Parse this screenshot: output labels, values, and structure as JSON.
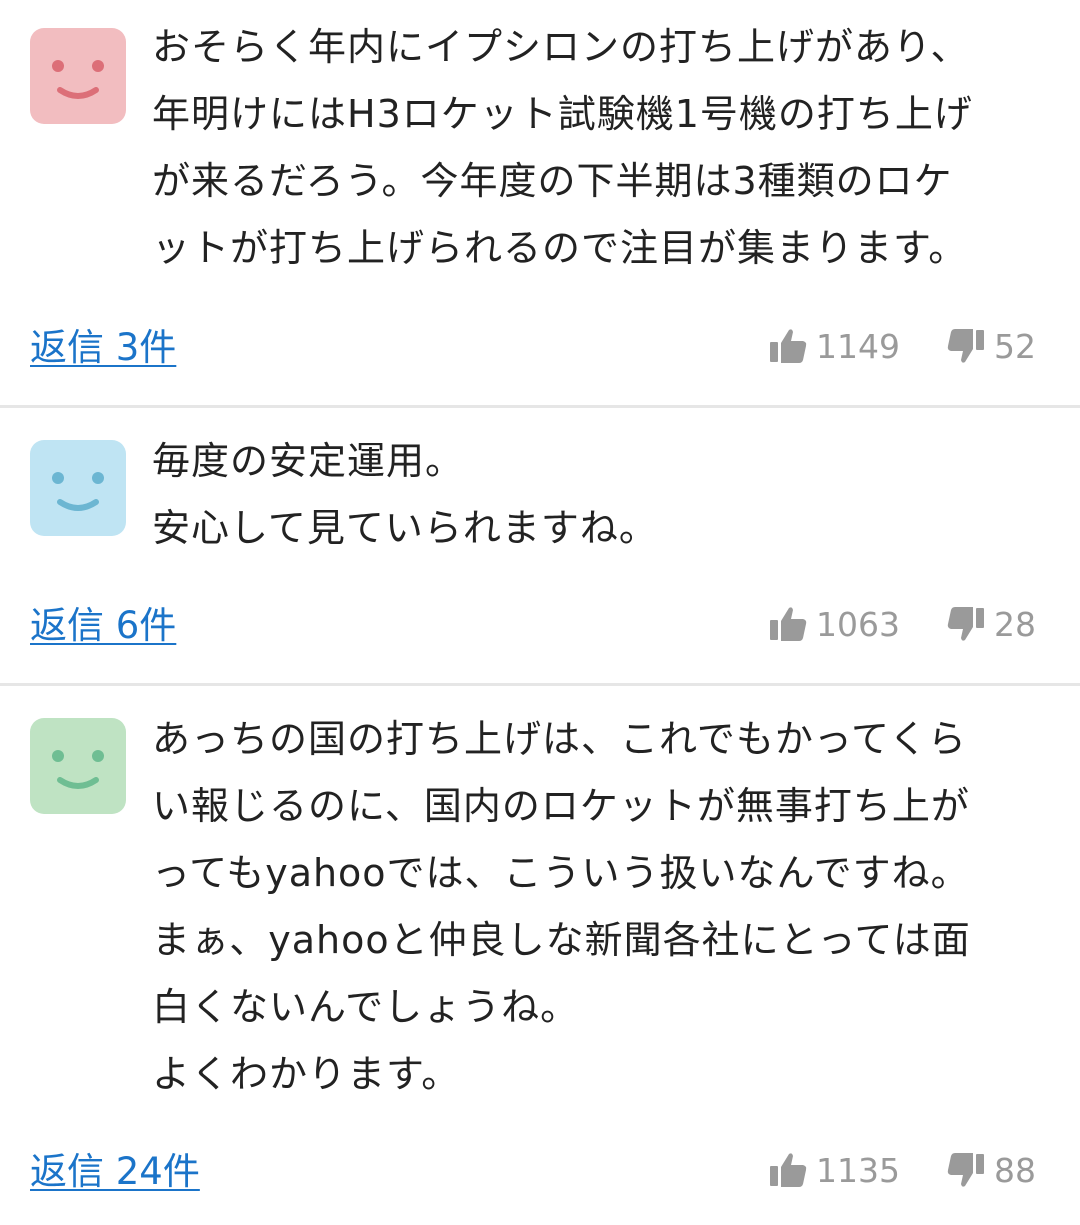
{
  "comments": [
    {
      "avatar_color": "#f2bdc0",
      "avatar_face_color": "#dc6f78",
      "lines": [
        "おそらく年内にイプシロンの打ち上げがあり、",
        "年明けにはH3ロケット試験機1号機の打ち上げ",
        "が来るだろう。今年度の下半期は3種類のロケ",
        "ットが打ち上げられるので注目が集まります。"
      ],
      "reply_label": "返信 3件",
      "likes": "1149",
      "dislikes": "52"
    },
    {
      "avatar_color": "#bfe4f3",
      "avatar_face_color": "#6cb6d2",
      "lines": [
        "毎度の安定運用。",
        "安心して見ていられますね。"
      ],
      "reply_label": "返信 6件",
      "likes": "1063",
      "dislikes": "28"
    },
    {
      "avatar_color": "#bfe3c3",
      "avatar_face_color": "#6fbe93",
      "lines": [
        "あっちの国の打ち上げは、これでもかってくら",
        "い報じるのに、国内のロケットが無事打ち上が",
        "ってもyahooでは、こういう扱いなんですね。",
        "まぁ、yahooと仲良しな新聞各社にとっては面",
        "白くないんでしょうね。",
        "よくわかります。"
      ],
      "reply_label": "返信 24件",
      "likes": "1135",
      "dislikes": "88"
    }
  ],
  "icons": {
    "like": "thumbs-up-icon",
    "dislike": "thumbs-down-icon",
    "avatar": "smiley-face-icon"
  },
  "colors": {
    "link": "#1b74c9",
    "vote_text": "#9a9a9a",
    "divider": "#e6e6e6"
  }
}
